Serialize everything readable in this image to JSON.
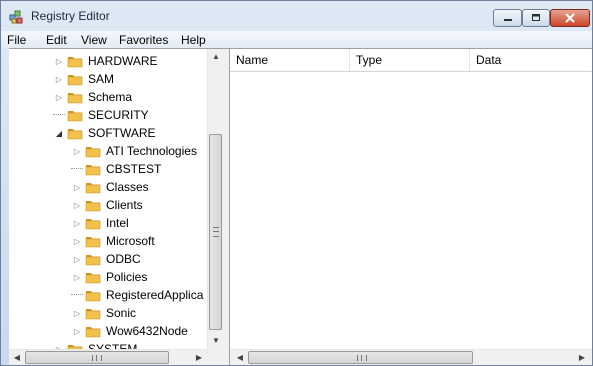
{
  "window": {
    "title": "Registry Editor"
  },
  "menu": [
    "File",
    "Edit",
    "View",
    "Favorites",
    "Help"
  ],
  "tree": {
    "items": [
      {
        "label": "HARDWARE",
        "expander": "collapsed",
        "indent": 0
      },
      {
        "label": "SAM",
        "expander": "collapsed",
        "indent": 0
      },
      {
        "label": "Schema",
        "expander": "collapsed",
        "indent": 0
      },
      {
        "label": "SECURITY",
        "expander": "none",
        "indent": 0
      },
      {
        "label": "SOFTWARE",
        "expander": "expanded",
        "indent": 0
      },
      {
        "label": "ATI Technologies",
        "expander": "collapsed",
        "indent": 1
      },
      {
        "label": "CBSTEST",
        "expander": "none",
        "indent": 1
      },
      {
        "label": "Classes",
        "expander": "collapsed",
        "indent": 1
      },
      {
        "label": "Clients",
        "expander": "collapsed",
        "indent": 1
      },
      {
        "label": "Intel",
        "expander": "collapsed",
        "indent": 1
      },
      {
        "label": "Microsoft",
        "expander": "collapsed",
        "indent": 1
      },
      {
        "label": "ODBC",
        "expander": "collapsed",
        "indent": 1
      },
      {
        "label": "Policies",
        "expander": "collapsed",
        "indent": 1
      },
      {
        "label": "RegisteredApplica",
        "expander": "none",
        "indent": 1
      },
      {
        "label": "Sonic",
        "expander": "collapsed",
        "indent": 1
      },
      {
        "label": "Wow6432Node",
        "expander": "collapsed",
        "indent": 1
      },
      {
        "label": "SYSTEM",
        "expander": "collapsed",
        "indent": 0
      }
    ]
  },
  "list": {
    "columns": [
      "Name",
      "Type",
      "Data"
    ]
  },
  "icons": {
    "app": "registry-icon",
    "folder": "folder-icon",
    "expand": "triangle-right-icon",
    "collapse": "triangle-down-icon"
  },
  "colors": {
    "folder": "#f2c04b",
    "folder_dark": "#c99522",
    "close": "#c9462c"
  }
}
